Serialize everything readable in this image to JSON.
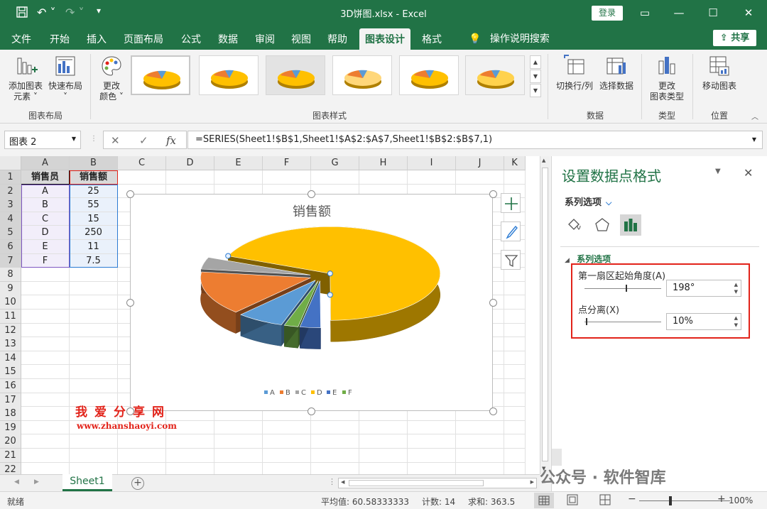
{
  "titlebar": {
    "title": "3D饼图.xlsx - Excel",
    "login": "登录",
    "save_icon": "save-icon",
    "undo_icon": "undo-icon",
    "redo_icon": "redo-icon"
  },
  "menu": {
    "tabs": [
      "文件",
      "开始",
      "插入",
      "页面布局",
      "公式",
      "数据",
      "审阅",
      "视图",
      "帮助",
      "图表设计",
      "格式"
    ],
    "search": "操作说明搜索",
    "share": "共享"
  },
  "ribbon": {
    "add_element": "添加图表\n元素",
    "quick_layout": "快速布局",
    "group_layout": "图表布局",
    "change_color": "更改\n颜色",
    "group_styles": "图表样式",
    "switch_rowcol": "切换行/列",
    "select_data": "选择数据",
    "group_data": "数据",
    "change_type": "更改\n图表类型",
    "group_type": "类型",
    "move_chart": "移动图表",
    "group_position": "位置"
  },
  "formula": {
    "namebox": "图表 2",
    "fx": "fx",
    "value": "=SERIES(Sheet1!$B$1,Sheet1!$A$2:$A$7,Sheet1!$B$2:$B$7,1)"
  },
  "grid": {
    "columns": [
      "A",
      "B",
      "C",
      "D",
      "E",
      "F",
      "G",
      "H",
      "I",
      "J",
      "K"
    ],
    "rows": [
      "1",
      "2",
      "3",
      "4",
      "5",
      "6",
      "7",
      "8",
      "9",
      "10",
      "11",
      "12",
      "13",
      "14",
      "15",
      "16",
      "17",
      "18",
      "19",
      "20",
      "21",
      "22"
    ],
    "headers": [
      "销售员",
      "销售额"
    ],
    "data": [
      [
        "A",
        "25"
      ],
      [
        "B",
        "55"
      ],
      [
        "C",
        "15"
      ],
      [
        "D",
        "250"
      ],
      [
        "E",
        "11"
      ],
      [
        "F",
        "7.5"
      ]
    ]
  },
  "chart_data": {
    "type": "pie",
    "title": "销售额",
    "categories": [
      "A",
      "B",
      "C",
      "D",
      "E",
      "F"
    ],
    "values": [
      25,
      55,
      15,
      250,
      11,
      7.5
    ],
    "colors": [
      "#5b9bd5",
      "#ed7d31",
      "#a5a5a5",
      "#ffc000",
      "#4472c4",
      "#70ad47"
    ],
    "first_slice_angle": 198,
    "explosion_percent": 10,
    "legend": "bottom"
  },
  "watermark": {
    "cn": "我爱分享网",
    "url": "www.zhanshaoyi.com"
  },
  "sheet": {
    "tab": "Sheet1"
  },
  "status": {
    "ready": "就绪",
    "average": "平均值: 60.58333333",
    "count": "计数: 14",
    "sum": "求和: 363.5",
    "zoom": "100%"
  },
  "pane": {
    "title": "设置数据点格式",
    "series_options": "系列选项",
    "section": "系列选项",
    "first_angle_label": "第一扇区起始角度(A)",
    "first_angle_value": "198°",
    "explosion_label": "点分离(X)",
    "explosion_value": "10%"
  },
  "wechat": "公众号 · 软件智库"
}
